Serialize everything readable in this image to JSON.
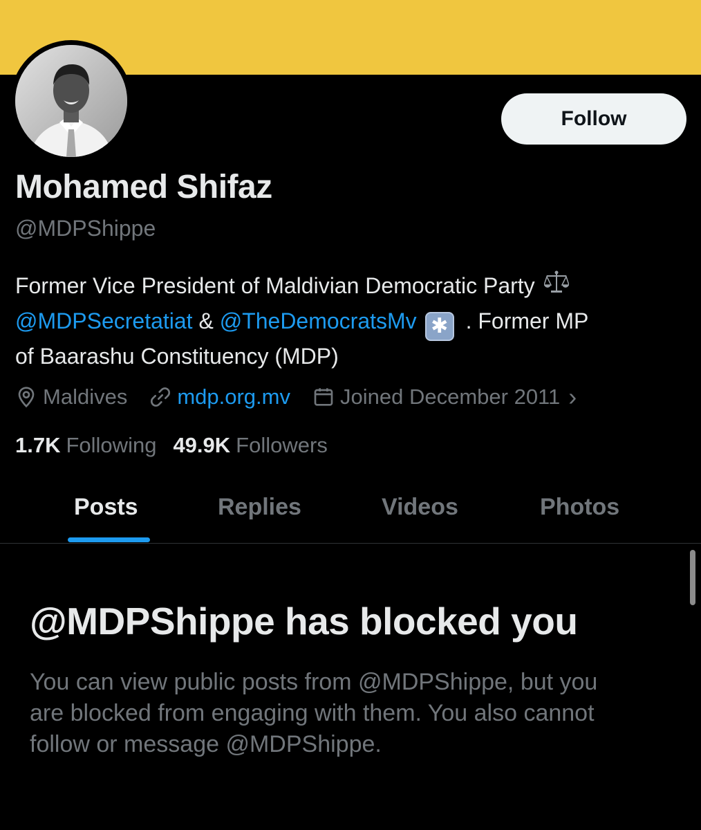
{
  "banner": {
    "color": "#f0c63f"
  },
  "profile": {
    "avatar_description": "profile-photo",
    "follow_label": "Follow",
    "display_name": "Mohamed Shifaz",
    "handle": "@MDPShippe",
    "bio": {
      "line1_text": "Former Vice President of Maldivian Democratic Party",
      "line1_emoji": "⚖️",
      "mention1": "@MDPSecretatiat",
      "ampersand": " & ",
      "mention2": "@TheDemocratsMv",
      "line2_emoji": "✱",
      "line2_tail": " . Former MP",
      "line3_text": "of Baarashu Constituency (MDP)"
    },
    "meta": {
      "location": "Maldives",
      "website": "mdp.org.mv",
      "joined": "Joined December 2011",
      "joined_chevron": "›"
    },
    "counts": {
      "following_count": "1.7K",
      "following_label": "Following",
      "followers_count": "49.9K",
      "followers_label": "Followers"
    }
  },
  "tabs": [
    {
      "label": "Posts",
      "active": true
    },
    {
      "label": "Replies",
      "active": false
    },
    {
      "label": "Videos",
      "active": false
    },
    {
      "label": "Photos",
      "active": false
    }
  ],
  "blocked": {
    "title": "@MDPShippe has blocked you",
    "line1": "You can view public posts from @MDPShippe, but you",
    "line2": "are blocked from engaging with them. You also cannot",
    "line3": "follow or message @MDPShippe."
  },
  "colors": {
    "accent": "#1d9bf0",
    "secondary_text": "#71767b",
    "primary_text": "#e7e9ea"
  }
}
